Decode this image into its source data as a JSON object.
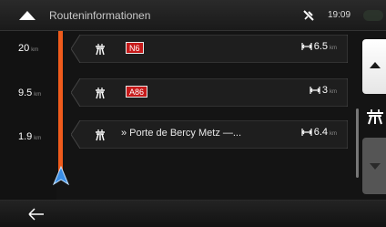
{
  "header": {
    "title": "Routeninformationen",
    "time": "19:09",
    "up_icon": "triangle-up-icon",
    "gps_icon": "satellite-icon"
  },
  "distance_column": [
    {
      "value": "20",
      "unit": "km"
    },
    {
      "value": "9.5",
      "unit": "km"
    },
    {
      "value": "1.9",
      "unit": "km"
    }
  ],
  "rows": [
    {
      "icon": "highway-icon",
      "badge": "N6",
      "street": "",
      "length": "6.5",
      "unit": "km"
    },
    {
      "icon": "highway-icon",
      "badge": "A86",
      "street": "",
      "length": "3",
      "unit": "km"
    },
    {
      "icon": "highway-icon",
      "badge": "",
      "street": "» Porte de Bercy Metz —...",
      "length": "6.4",
      "unit": "km"
    }
  ],
  "colors": {
    "route": "#ef5b1c",
    "badge": "#c61a1a",
    "vehicle": "#3a8ee6"
  },
  "side_controls": {
    "scroll_up_icon": "triangle-up-icon",
    "scroll_down_icon": "triangle-down-icon",
    "filter_icon": "highway-icon"
  },
  "footer": {
    "back_icon": "arrow-left-icon"
  }
}
